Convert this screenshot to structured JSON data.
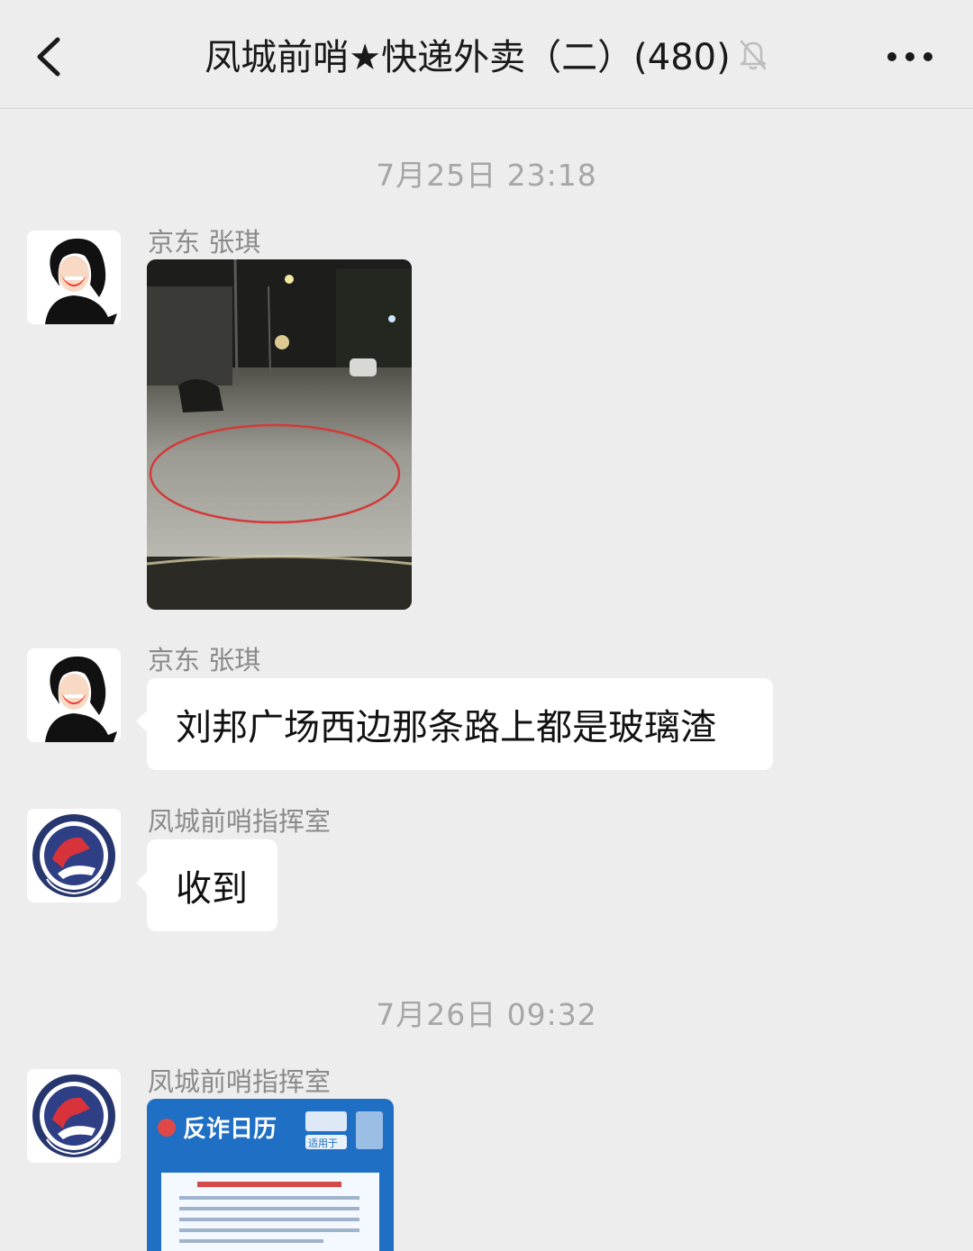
{
  "header": {
    "title": "凤城前哨★快递外卖（二）(480)",
    "back_icon": "chevron-left-icon",
    "mute_icon": "bell-off-icon",
    "more_icon": "more-dots-icon"
  },
  "messages": [
    {
      "type": "timestamp",
      "text": "7月25日 23:18"
    },
    {
      "type": "image",
      "sender": "京东 张琪",
      "avatar": "cartoon-girl-avatar",
      "content": "night-road-photo"
    },
    {
      "type": "text",
      "sender": "京东 张琪",
      "avatar": "cartoon-girl-avatar",
      "text": "刘邦广场西边那条路上都是玻璃渣"
    },
    {
      "type": "text",
      "sender": "凤城前哨指挥室",
      "avatar": "police-emblem-avatar",
      "text": "收到"
    },
    {
      "type": "timestamp",
      "text": "7月26日 09:32"
    },
    {
      "type": "image",
      "sender": "凤城前哨指挥室",
      "avatar": "police-emblem-avatar",
      "content": "calendar-card-image"
    }
  ],
  "calendar_card": {
    "title": "反诈日历",
    "badge": "适用于"
  },
  "colors": {
    "background": "#ededed",
    "bubble": "#ffffff",
    "card_blue": "#1f6fc4",
    "annotation_red": "#d23a3a"
  }
}
